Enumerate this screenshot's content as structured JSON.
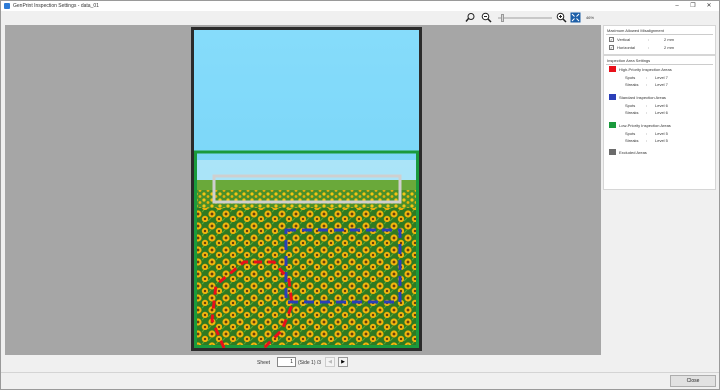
{
  "window": {
    "title": "GenPrint Inspection Settings - data_01",
    "minimize": "–",
    "restore": "❐",
    "close": "✕"
  },
  "toolbar": {
    "zoom_value": "46%",
    "zoom_level": 0.05,
    "icons": [
      "pan-hand-icon",
      "zoom-out-icon",
      "zoom-in-icon",
      "fit-page-icon"
    ]
  },
  "pager": {
    "sheet_label": "Sheet",
    "sheet_value": "1",
    "side_text": "(Side 1) /3",
    "prev_label": "◀",
    "next_label": "▶"
  },
  "panel": {
    "misalignment": {
      "title": "Maximum Allowed Misalignment",
      "rows": [
        {
          "label": "Vertical",
          "sep": ":",
          "value": "2 mm",
          "checked": true
        },
        {
          "label": "Horizontal",
          "sep": ":",
          "value": "2 mm",
          "checked": true
        }
      ]
    },
    "inspection": {
      "title": "Inspection Area Settings",
      "areas": [
        {
          "name": "High-Priority Inspection Areas",
          "color": "#e8101a",
          "spots_label": "Spots",
          "spots": "Level 7",
          "streaks_label": "Streaks",
          "streaks": "Level 7"
        },
        {
          "name": "Standard Inspection Areas",
          "color": "#2b3fb8",
          "spots_label": "Spots",
          "spots": "Level 6",
          "streaks_label": "Streaks",
          "streaks": "Level 6"
        },
        {
          "name": "Low-Priority Inspection Areas",
          "color": "#1a9a3c",
          "spots_label": "Spots",
          "spots": "Level 5",
          "streaks_label": "Streaks",
          "streaks": "Level 5"
        }
      ],
      "excluded": {
        "name": "Excluded Areas",
        "color": "#6b6b6b"
      },
      "sep": ":"
    }
  },
  "footer": {
    "close_label": "Close"
  }
}
